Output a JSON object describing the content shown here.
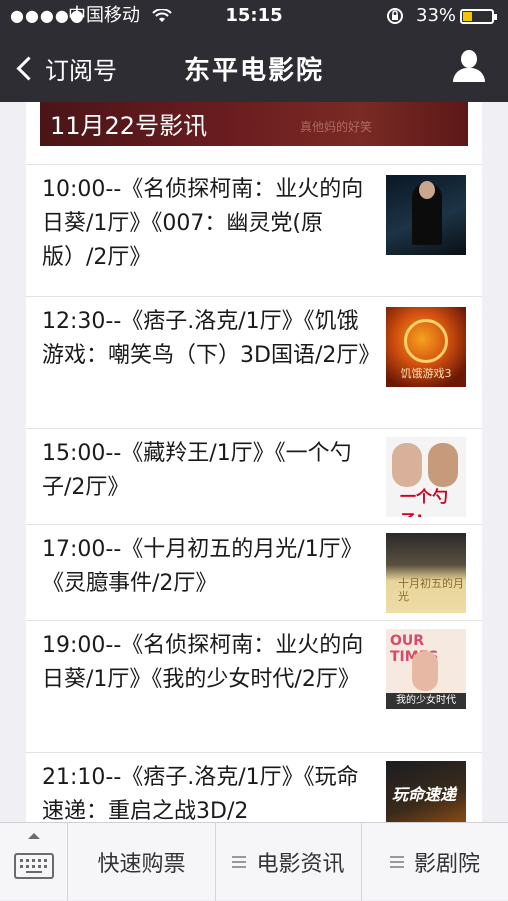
{
  "status_bar": {
    "signal": "●●●●●",
    "carrier": "中国移动",
    "time": "15:15",
    "battery": "33%"
  },
  "nav": {
    "back_label": "订阅号",
    "title": "东平电影院"
  },
  "banner": {
    "title": "11月22号影讯",
    "deco_text": "真他妈的好笑"
  },
  "schedule": [
    {
      "text": "10:00--《名侦探柯南：业火的向日葵/1厅》《007：幽灵党(原版）/2厅》",
      "poster": "poster-detective-conan-007"
    },
    {
      "text": "12:30--《痞子.洛克/1厅》《饥饿游戏：嘲笑鸟（下）3D国语/2厅》",
      "poster": "poster-hunger-games",
      "poster_caption": "饥饿游戏3"
    },
    {
      "text": "15:00--《藏羚王/1厅》《一个勺子/2厅》",
      "poster": "poster-yi-ge-shao-zi",
      "poster_caption": "一个勺子!"
    },
    {
      "text": "17:00--《十月初五的月光/1厅》《灵臆事件/2厅》",
      "poster": "poster-moonlight",
      "poster_caption": "十月初五的月光"
    },
    {
      "text": "19:00--《名侦探柯南：业火的向日葵/1厅》《我的少女时代/2厅》",
      "poster": "poster-our-times",
      "poster_caption": "OUR TIMES",
      "poster_caption2": "我的少女时代"
    },
    {
      "text": "21:10--《痞子.洛克/1厅》《玩命速递：重启之战3D/2",
      "poster": "poster-transporter",
      "poster_caption": "玩命速递"
    }
  ],
  "bottom_menu": {
    "items": [
      "快速购票",
      "电影资讯",
      "影剧院"
    ]
  },
  "colors": {
    "nav_bg": "#2e2d33",
    "banner_bg": "#6b1d20",
    "battery": "#f5c400"
  }
}
